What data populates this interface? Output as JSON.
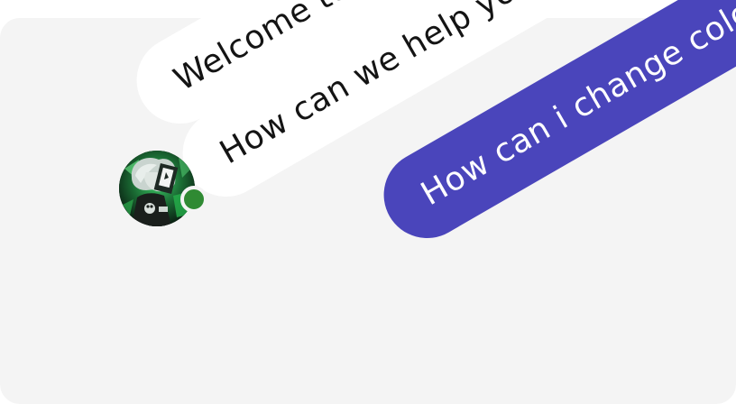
{
  "chat": {
    "messages": [
      {
        "text": "Welcome to our chat!",
        "from": "agent"
      },
      {
        "text": "How can we help you today?",
        "from": "agent"
      },
      {
        "text": "How can i change colors?",
        "from": "user"
      }
    ],
    "agent": {
      "status": "online",
      "status_color": "#2f8a33",
      "avatar_description": "anime-style character avatar"
    }
  },
  "colors": {
    "panel_background": "#f4f4f4",
    "incoming_bubble": "#ffffff",
    "outgoing_bubble": "#4a45bb",
    "incoming_text": "#141414",
    "outgoing_text": "#ffffff"
  }
}
